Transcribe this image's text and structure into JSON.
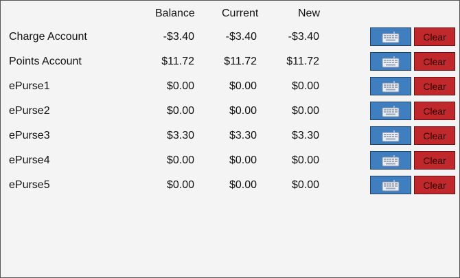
{
  "headers": {
    "balance": "Balance",
    "current": "Current",
    "new": "New"
  },
  "rows": [
    {
      "name": "Charge Account",
      "balance": "-$3.40",
      "current": "-$3.40",
      "new": "-$3.40"
    },
    {
      "name": "Points Account",
      "balance": "$11.72",
      "current": "$11.72",
      "new": "$11.72"
    },
    {
      "name": "ePurse1",
      "balance": "$0.00",
      "current": "$0.00",
      "new": "$0.00"
    },
    {
      "name": "ePurse2",
      "balance": "$0.00",
      "current": "$0.00",
      "new": "$0.00"
    },
    {
      "name": "ePurse3",
      "balance": "$3.30",
      "current": "$3.30",
      "new": "$3.30"
    },
    {
      "name": "ePurse4",
      "balance": "$0.00",
      "current": "$0.00",
      "new": "$0.00"
    },
    {
      "name": "ePurse5",
      "balance": "$0.00",
      "current": "$0.00",
      "new": "$0.00"
    }
  ],
  "buttons": {
    "clear_label": "Clear",
    "keyboard_icon": "keyboard-icon"
  },
  "colors": {
    "keyboard_button": "#3f7fbf",
    "clear_button": "#c0282c"
  }
}
